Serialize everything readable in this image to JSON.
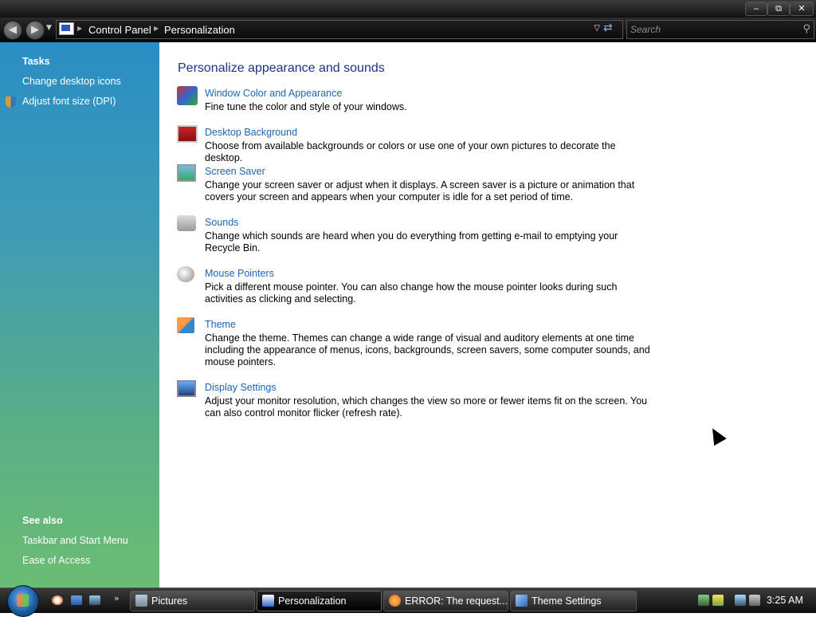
{
  "window": {
    "controls": {
      "minimize": "‒",
      "maximize": "⧉",
      "close": "✕"
    }
  },
  "address_bar": {
    "breadcrumb": [
      "Control Panel",
      "Personalization"
    ],
    "search_placeholder": "Search"
  },
  "sidebar": {
    "tasks_heading": "Tasks",
    "tasks": [
      {
        "label": "Change desktop icons"
      },
      {
        "label": "Adjust font size (DPI)",
        "icon": "uac-shield-icon"
      }
    ],
    "see_also_heading": "See also",
    "see_also": [
      {
        "label": "Taskbar and Start Menu"
      },
      {
        "label": "Ease of Access"
      }
    ]
  },
  "main": {
    "title": "Personalize appearance and sounds",
    "items": [
      {
        "link": "Window Color and Appearance",
        "desc": "Fine tune the color and style of your windows.",
        "icon": "window-color-icon"
      },
      {
        "link": "Desktop Background",
        "desc": "Choose from available backgrounds or colors or use one of your own pictures to decorate the desktop.",
        "icon": "desktop-background-icon"
      },
      {
        "link": "Screen Saver",
        "desc": "Change your screen saver or adjust when it displays. A screen saver is a picture or animation that covers your screen and appears when your computer is idle for a set period of time.",
        "icon": "screen-saver-icon"
      },
      {
        "link": "Sounds",
        "desc": "Change which sounds are heard when you do everything from getting e-mail to emptying your Recycle Bin.",
        "icon": "sounds-icon"
      },
      {
        "link": "Mouse Pointers",
        "desc": "Pick a different mouse pointer. You can also change how the mouse pointer looks during such activities as clicking and selecting.",
        "icon": "mouse-pointers-icon"
      },
      {
        "link": "Theme",
        "desc": "Change the theme. Themes can change a wide range of visual and auditory elements at one time including the appearance of menus, icons, backgrounds, screen savers, some computer sounds, and mouse pointers.",
        "icon": "theme-icon"
      },
      {
        "link": "Display Settings",
        "desc": "Adjust your monitor resolution, which changes the view so more or fewer items fit on the screen. You can also control monitor flicker (refresh rate).",
        "icon": "display-settings-icon"
      }
    ]
  },
  "taskbar": {
    "buttons": [
      {
        "label": "Pictures",
        "icon": "folder-icon"
      },
      {
        "label": "Personalization",
        "icon": "control-panel-icon"
      },
      {
        "label": "ERROR: The request...",
        "icon": "firefox-icon"
      },
      {
        "label": "Theme Settings",
        "icon": "theme-settings-icon"
      }
    ],
    "clock": "3:25 AM"
  },
  "colors": {
    "link": "#1e64b4",
    "heading": "#1e3287"
  }
}
